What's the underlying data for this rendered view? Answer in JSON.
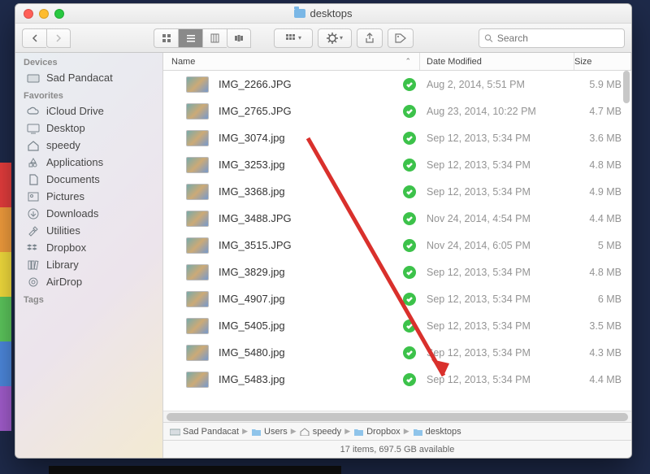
{
  "window": {
    "title": "desktops"
  },
  "search": {
    "placeholder": "Search"
  },
  "columns": {
    "name": "Name",
    "date": "Date Modified",
    "size": "Size"
  },
  "sidebar": {
    "groups": [
      {
        "label": "Devices",
        "items": [
          {
            "label": "Sad Pandacat",
            "icon": "hdd-icon"
          }
        ]
      },
      {
        "label": "Favorites",
        "items": [
          {
            "label": "iCloud Drive",
            "icon": "cloud-icon"
          },
          {
            "label": "Desktop",
            "icon": "desktop-icon"
          },
          {
            "label": "speedy",
            "icon": "home-icon"
          },
          {
            "label": "Applications",
            "icon": "apps-icon"
          },
          {
            "label": "Documents",
            "icon": "documents-icon"
          },
          {
            "label": "Pictures",
            "icon": "pictures-icon"
          },
          {
            "label": "Downloads",
            "icon": "downloads-icon"
          },
          {
            "label": "Utilities",
            "icon": "utilities-icon"
          },
          {
            "label": "Dropbox",
            "icon": "dropbox-icon"
          },
          {
            "label": "Library",
            "icon": "library-icon"
          },
          {
            "label": "AirDrop",
            "icon": "airdrop-icon"
          }
        ]
      },
      {
        "label": "Tags",
        "items": []
      }
    ]
  },
  "files": [
    {
      "name": "IMG_2266.JPG",
      "date": "Aug 2, 2014, 5:51 PM",
      "size": "5.9 MB"
    },
    {
      "name": "IMG_2765.JPG",
      "date": "Aug 23, 2014, 10:22 PM",
      "size": "4.7 MB"
    },
    {
      "name": "IMG_3074.jpg",
      "date": "Sep 12, 2013, 5:34 PM",
      "size": "3.6 MB"
    },
    {
      "name": "IMG_3253.jpg",
      "date": "Sep 12, 2013, 5:34 PM",
      "size": "4.8 MB"
    },
    {
      "name": "IMG_3368.jpg",
      "date": "Sep 12, 2013, 5:34 PM",
      "size": "4.9 MB"
    },
    {
      "name": "IMG_3488.JPG",
      "date": "Nov 24, 2014, 4:54 PM",
      "size": "4.4 MB"
    },
    {
      "name": "IMG_3515.JPG",
      "date": "Nov 24, 2014, 6:05 PM",
      "size": "5 MB"
    },
    {
      "name": "IMG_3829.jpg",
      "date": "Sep 12, 2013, 5:34 PM",
      "size": "4.8 MB"
    },
    {
      "name": "IMG_4907.jpg",
      "date": "Sep 12, 2013, 5:34 PM",
      "size": "6 MB"
    },
    {
      "name": "IMG_5405.jpg",
      "date": "Sep 12, 2013, 5:34 PM",
      "size": "3.5 MB"
    },
    {
      "name": "IMG_5480.jpg",
      "date": "Sep 12, 2013, 5:34 PM",
      "size": "4.3 MB"
    },
    {
      "name": "IMG_5483.jpg",
      "date": "Sep 12, 2013, 5:34 PM",
      "size": "4.4 MB"
    }
  ],
  "path": [
    {
      "label": "Sad Pandacat",
      "icon": "hdd"
    },
    {
      "label": "Users",
      "icon": "folder"
    },
    {
      "label": "speedy",
      "icon": "home"
    },
    {
      "label": "Dropbox",
      "icon": "folder"
    },
    {
      "label": "desktops",
      "icon": "folder"
    }
  ],
  "status": "17 items, 697.5 GB available"
}
